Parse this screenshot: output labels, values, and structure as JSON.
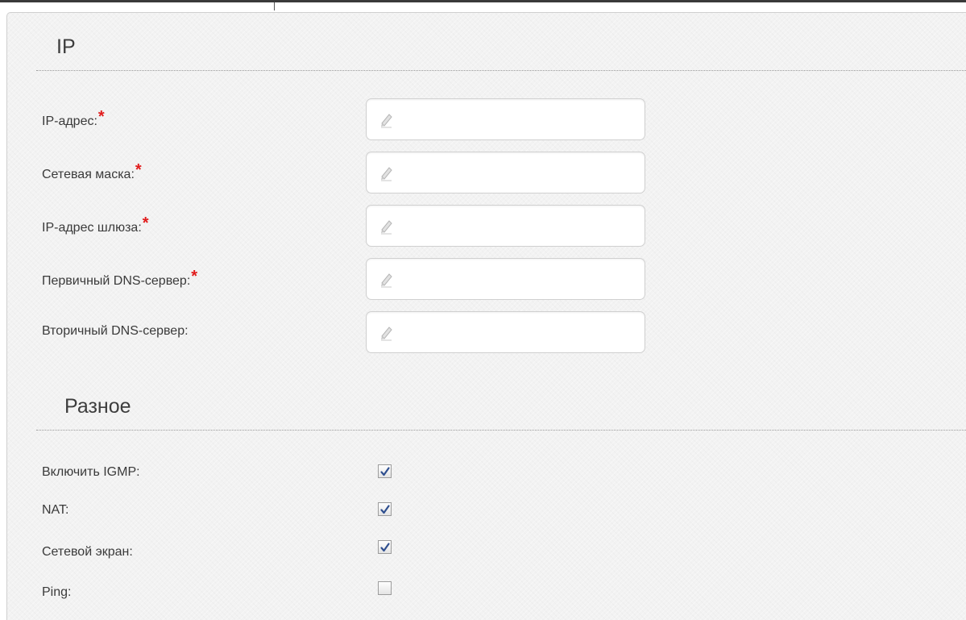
{
  "sections": {
    "ip": {
      "title": "IP",
      "fields": [
        {
          "label": "IP-адрес:",
          "required": "*",
          "value": "",
          "icon": "pencil-icon"
        },
        {
          "label": "Сетевая маска:",
          "required": "*",
          "value": "",
          "icon": "pencil-icon"
        },
        {
          "label": "IP-адрес шлюза:",
          "required": "*",
          "value": "",
          "icon": "pencil-icon"
        },
        {
          "label": "Первичный DNS-сервер:",
          "required": "*",
          "value": "",
          "icon": "pencil-icon"
        },
        {
          "label": "Вторичный DNS-сервер:",
          "required": "",
          "value": "",
          "icon": "pencil-icon"
        }
      ]
    },
    "misc": {
      "title": "Разное",
      "options": [
        {
          "label": "Включить IGMP:",
          "checked": true
        },
        {
          "label": "NAT:",
          "checked": true
        },
        {
          "label": "Сетевой экран:",
          "checked": true
        },
        {
          "label": "Ping:",
          "checked": false
        }
      ]
    }
  },
  "colors": {
    "required_marker": "#e11b1b",
    "checkmark": "#2f4f8f",
    "panel_background": "#f2f2f2"
  }
}
